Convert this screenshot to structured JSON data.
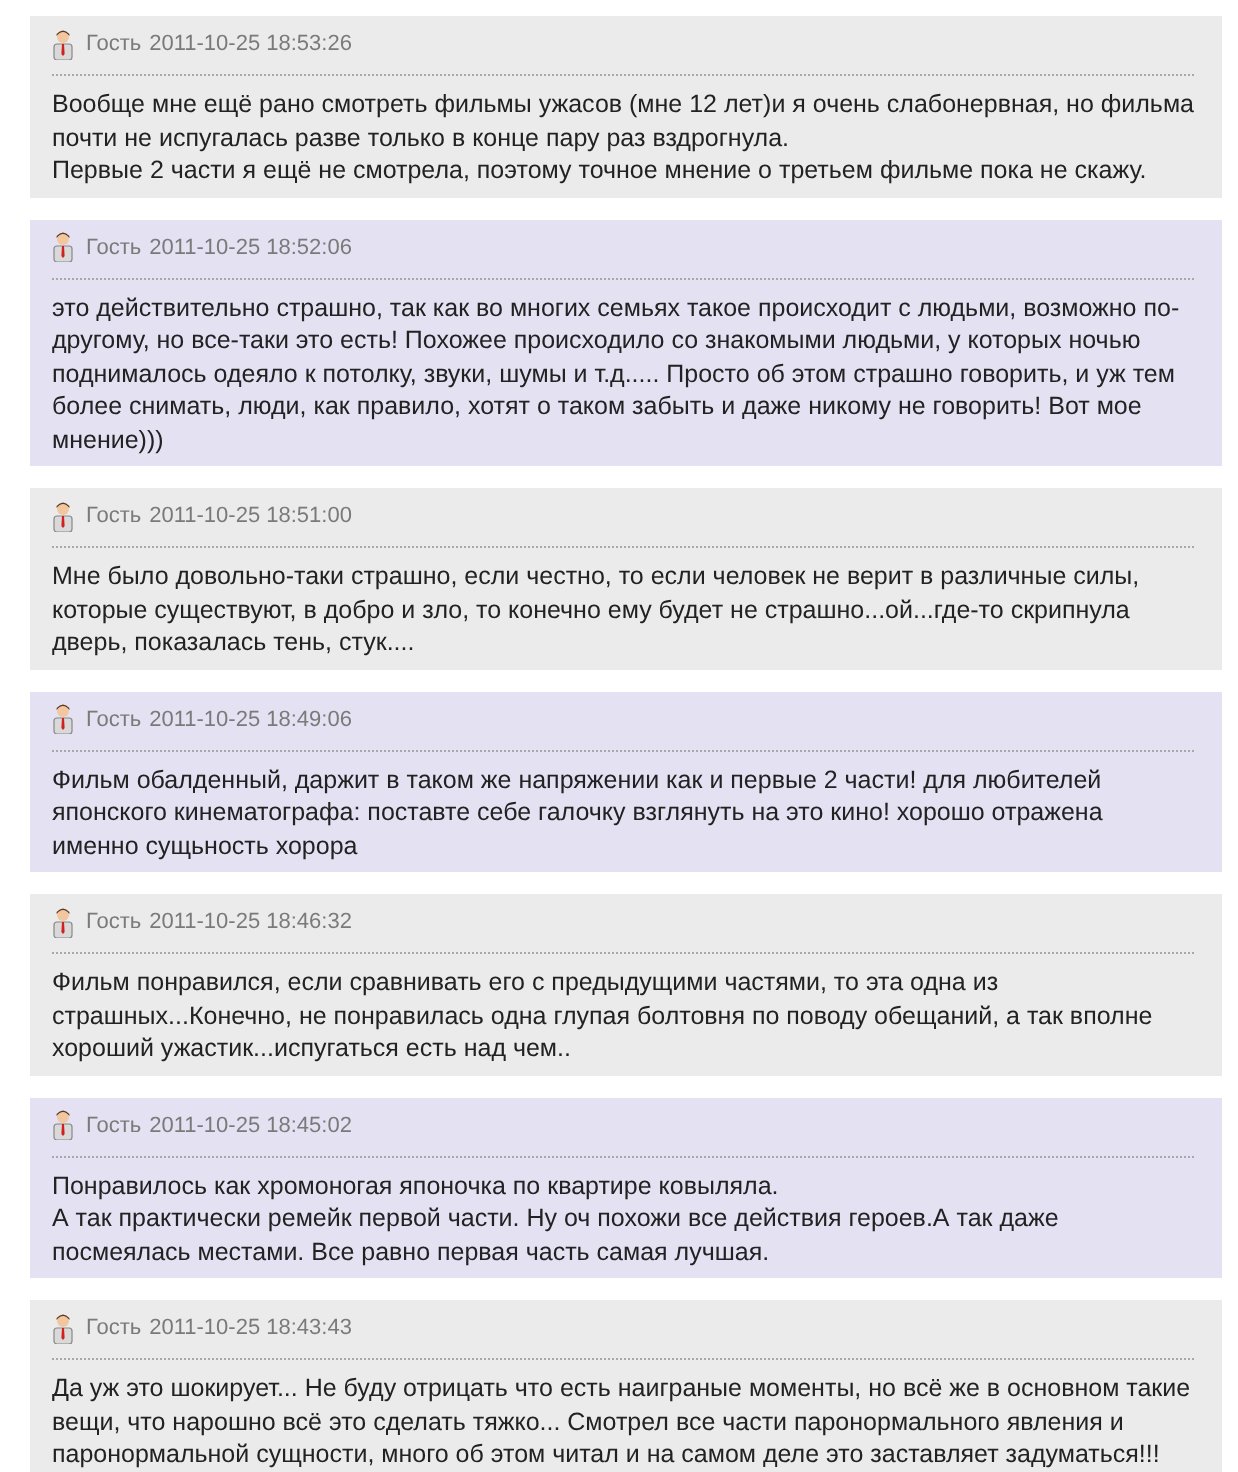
{
  "comments": [
    {
      "author": "Гость",
      "time": "2011-10-25 18:53:26",
      "text": "Вообще мне ещё рано смотреть фильмы ужасов (мне 12 лет)и я очень слабонервная, но фильма почти не испугалась разве только в конце пару раз вздрогнула.\nПервые 2 части я ещё не смотрела, поэтому точное мнение о третьем фильме пока не скажу."
    },
    {
      "author": "Гость",
      "time": "2011-10-25 18:52:06",
      "text": "это действительно страшно, так как во многих семьях такое происходит с людьми, возможно по-другому, но все-таки это есть! Похожее происходило со знакомыми людьми, у которых ночью поднималось одеяло к потолку, звуки, шумы и т.д..... Просто об этом страшно говорить, и уж тем более снимать, люди, как правило, хотят о таком забыть и даже никому не говорить! Вот мое мнение)))"
    },
    {
      "author": "Гость",
      "time": "2011-10-25 18:51:00",
      "text": "Мне было довольно-таки страшно, если честно, то если человек не верит в различные силы, которые существуют, в добро и зло, то конечно ему будет не страшно...ой...где-то скрипнула дверь, показалась тень, стук...."
    },
    {
      "author": "Гость",
      "time": "2011-10-25 18:49:06",
      "text": "Фильм обалденный, даржит в таком же напряжении как и первые 2 части! для любителей японского кинематографа: поставте себе галочку взглянуть на это кино! хорошо отражена именно сущьность хорора"
    },
    {
      "author": "Гость",
      "time": "2011-10-25 18:46:32",
      "text": "Фильм понравился, если сравнивать его с предыдущими частями, то эта одна из страшных...Конечно, не понравилась одна глупая болтовня по поводу обещаний, а так вполне хороший ужастик...испугаться есть над чем.."
    },
    {
      "author": "Гость",
      "time": "2011-10-25 18:45:02",
      "text": "Понравилось как хромоногая японочка по квартире ковыляла.\nА так практически ремейк первой части. Ну оч похожи все действия героев.А так даже посмеялась местами. Все равно первая часть самая лучшая."
    },
    {
      "author": "Гость",
      "time": "2011-10-25 18:43:43",
      "text": "Да уж это шокирует... Не буду отрицать что есть наиграные моменты, но всё же в основном такие вещи, что нарошно всё это сделать тяжко... Смотрел все части паронормального явления и паронормальной сущности, много об этом читал и на самом деле это заставляет задуматься!!!"
    }
  ]
}
